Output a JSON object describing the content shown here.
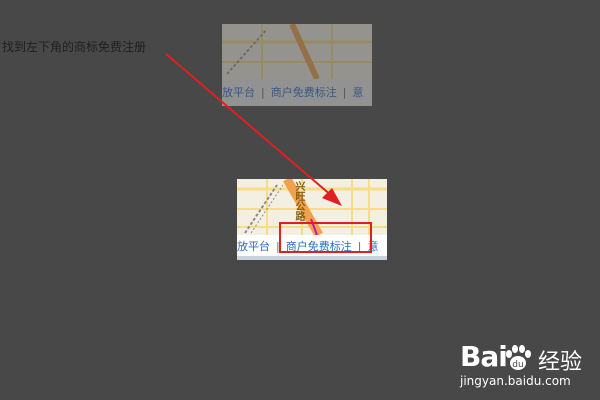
{
  "instruction": "找到左下角的商标免费注册",
  "thumbnail_top": {
    "links": [
      "放平台",
      "|",
      "商户免费标注",
      "|",
      "意"
    ]
  },
  "thumbnail_main": {
    "road_label": "兴旺公路",
    "links": [
      "放平台",
      "|",
      "商户免费标注",
      "|",
      "意"
    ]
  },
  "colors": {
    "background": "#484848",
    "link": "#2b6cc4",
    "annotation": "#e02020"
  },
  "watermark": {
    "logo": "Bai",
    "logo_suffix": "du",
    "cn": "经验",
    "url": "jingyan.baidu.com"
  }
}
